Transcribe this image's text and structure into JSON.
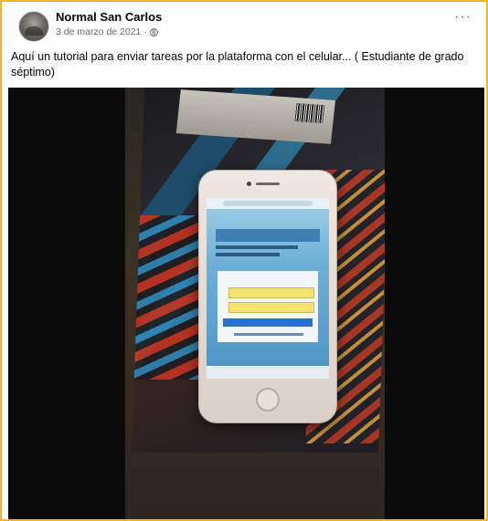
{
  "post": {
    "page_name": "Normal San Carlos",
    "timestamp": "3 de marzo de 2021 ·",
    "privacy_icon": "globe-icon",
    "more_label": "···",
    "text": "Aquí un tutorial para enviar tareas por la plataforma con el celular... ( Estudiante de grado séptimo)"
  },
  "colors": {
    "frame_border": "#f2b824",
    "name_text": "#050505",
    "meta_text": "#65676b"
  }
}
